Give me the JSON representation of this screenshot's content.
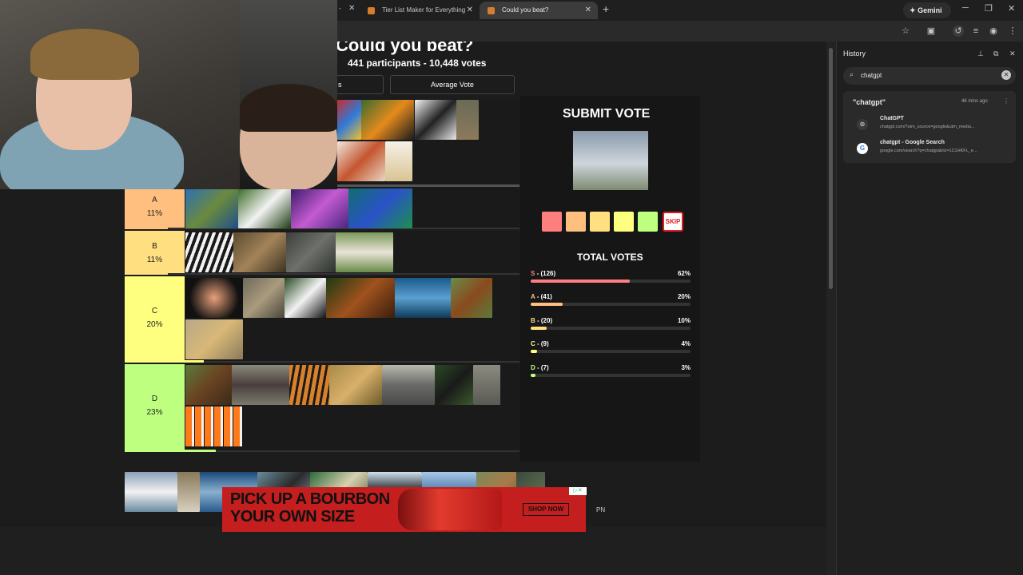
{
  "browser": {
    "tabs": [
      {
        "title": "Tier List Maker for Everything"
      },
      {
        "title": "Could you beat?"
      }
    ],
    "gemini_label": "Gemini"
  },
  "page": {
    "title": "Could you beat?",
    "participants": "441 participants - 10,448 votes",
    "tab_left_label": "s",
    "tab_average_label": "Average Vote",
    "tiers": [
      {
        "label": "A",
        "percent": "11%",
        "color": "#ffbf7f",
        "progress": 0.11
      },
      {
        "label": "B",
        "percent": "11%",
        "color": "#ffdf7f",
        "progress": 0.11
      },
      {
        "label": "C",
        "percent": "20%",
        "color": "#ffff7f",
        "progress": 0.2
      },
      {
        "label": "D",
        "percent": "23%",
        "color": "#bfff7f",
        "progress": 0.23
      }
    ],
    "submit_title": "SUBMIT VOTE",
    "vote_colors": [
      "#ff7f7f",
      "#ffbf7f",
      "#ffdf7f",
      "#ffff7f",
      "#bfff7f"
    ],
    "skip_label": "SKIP",
    "total_votes_title": "TOTAL VOTES",
    "total_votes": [
      {
        "tier": "S",
        "count": " - (126)",
        "percent": "62%",
        "value": 0.62,
        "color": "#ff7f7f"
      },
      {
        "tier": "A",
        "count": " - (41)",
        "percent": "20%",
        "value": 0.2,
        "color": "#ffbf7f"
      },
      {
        "tier": "B",
        "count": " - (20)",
        "percent": "10%",
        "value": 0.1,
        "color": "#ffdf7f"
      },
      {
        "tier": "C",
        "count": " - (9)",
        "percent": "4%",
        "value": 0.04,
        "color": "#ffff7f"
      },
      {
        "tier": "D",
        "count": " - (7)",
        "percent": "3%",
        "value": 0.03,
        "color": "#bfff7f"
      }
    ]
  },
  "ad": {
    "line1": "PICK UP A BOURBON",
    "line2": "YOUR OWN SIZE",
    "cta": "SHOP NOW",
    "side": "PN"
  },
  "history": {
    "title": "History",
    "search_query": "chatgpt",
    "group_title": "\"chatgpt\"",
    "group_time": "46 mins ago",
    "items": [
      {
        "title": "ChatGPT",
        "url": "chatgpt.com/?utm_source=google&utm_mediu..."
      },
      {
        "title": "chatgpt - Google Search",
        "url": "google.com/search?q=chatgpt&rlz=1C1HKFL_e..."
      }
    ]
  }
}
